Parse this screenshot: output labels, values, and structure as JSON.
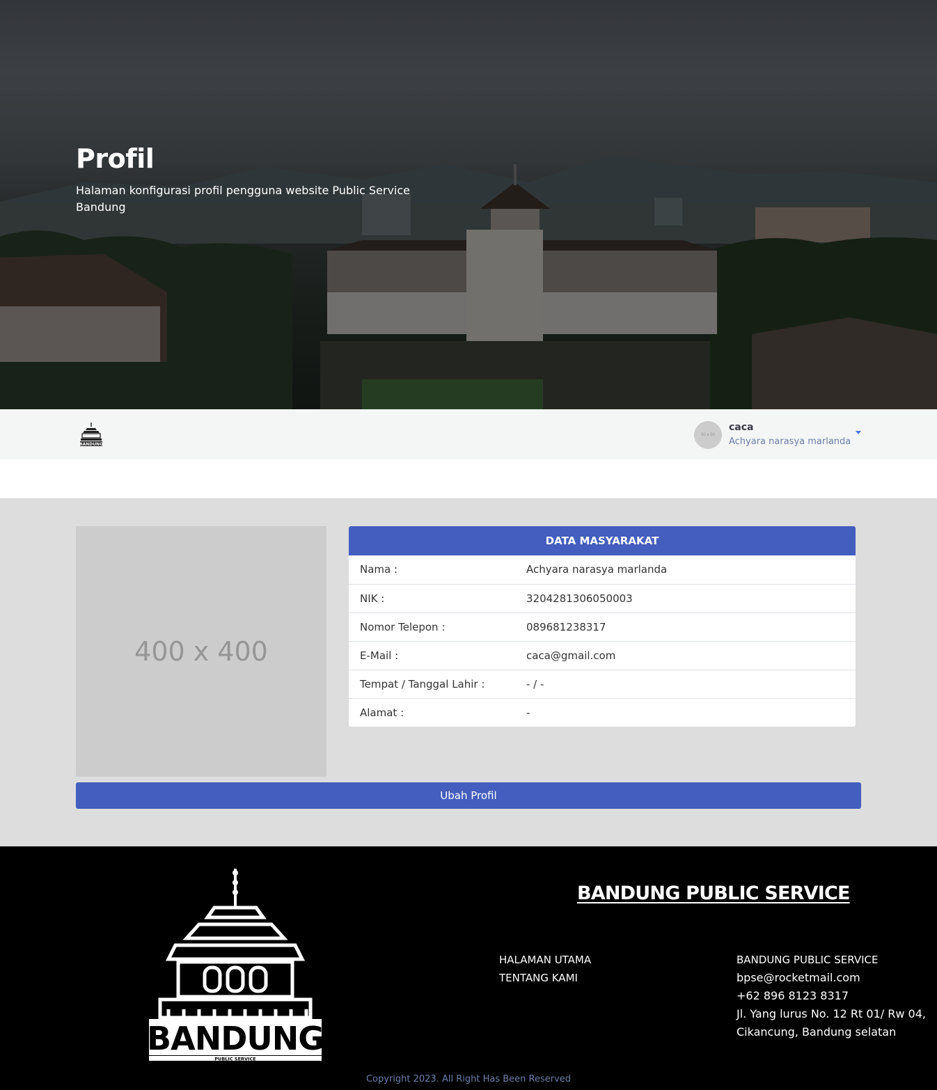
{
  "hero": {
    "title": "Profil",
    "subtitle": "Halaman konfigurasi profil pengguna website Public Service Bandung"
  },
  "navbar": {
    "user": {
      "avatar_placeholder": "50 x 50",
      "username": "caca",
      "full_name": "Achyara narasya marlanda"
    }
  },
  "profile": {
    "photo_placeholder": "400 x 400",
    "card_title": "DATA MASYARAKAT",
    "fields": [
      {
        "label": "Nama :",
        "value": "Achyara narasya marlanda"
      },
      {
        "label": "NIK :",
        "value": "3204281306050003"
      },
      {
        "label": "Nomor Telepon :",
        "value": "089681238317"
      },
      {
        "label": "E-Mail :",
        "value": "caca@gmail.com"
      },
      {
        "label": "Tempat / Tanggal Lahir :",
        "value": "- / -"
      },
      {
        "label": "Alamat :",
        "value": "-"
      }
    ],
    "edit_button": "Ubah Profil"
  },
  "footer": {
    "brand": "BANDUNG PUBLIC SERVICE",
    "logo_text": "BANDUNG",
    "logo_subtext": "PUBLIC SERVICE",
    "links": [
      "HALAMAN UTAMA",
      "TENTANG KAMI"
    ],
    "contact": {
      "name": "BANDUNG PUBLIC SERVICE",
      "email": "bpse@rocketmail.com",
      "phone": "+62 896 8123 8317",
      "address_line1": "Jl. Yang lurus No. 12 Rt 01/ Rw 04,",
      "address_line2": "Cikancung, Bandung selatan"
    },
    "copyright": "Copyright 2023. All Right Has Been Reserved"
  }
}
